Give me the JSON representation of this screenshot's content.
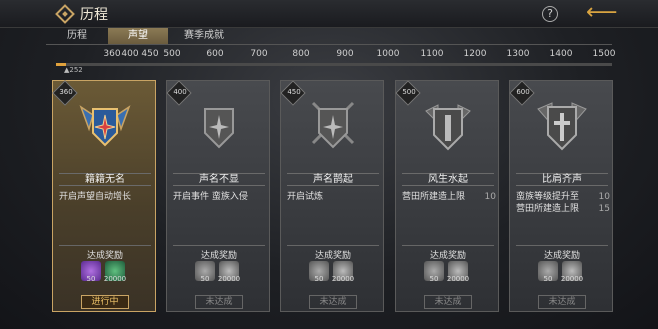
{
  "header": {
    "title": "历程"
  },
  "tabs": [
    {
      "label": "历程"
    },
    {
      "label": "声望",
      "active": true
    },
    {
      "label": "赛季成就"
    }
  ],
  "ruler": {
    "ticks": [
      "360",
      "400",
      "450",
      "500",
      "600",
      "700",
      "800",
      "900",
      "1000",
      "1100",
      "1200",
      "1300",
      "1400",
      "1500"
    ],
    "current": "252",
    "accent": "#e0a13c"
  },
  "cards": [
    {
      "level": "360",
      "name": "籍籍无名",
      "desc": [
        "开启声望自动增长"
      ],
      "reward_title": "达成奖励",
      "rewards": [
        {
          "icon": "purple-badge-icon",
          "qty": "50"
        },
        {
          "icon": "green-coin-icon",
          "qty": "20000"
        }
      ],
      "status": "进行中",
      "unlocked": true
    },
    {
      "level": "400",
      "name": "声名不显",
      "desc": [
        "开启事件 蛮族入侵"
      ],
      "reward_title": "达成奖励",
      "rewards": [
        {
          "icon": "badge-icon",
          "qty": "50"
        },
        {
          "icon": "coin-icon",
          "qty": "20000"
        }
      ],
      "status": "未达成",
      "unlocked": false
    },
    {
      "level": "450",
      "name": "声名鹊起",
      "desc": [
        "开启试炼"
      ],
      "reward_title": "达成奖励",
      "rewards": [
        {
          "icon": "badge-icon",
          "qty": "50"
        },
        {
          "icon": "coin-icon",
          "qty": "20000"
        }
      ],
      "status": "未达成",
      "unlocked": false
    },
    {
      "level": "500",
      "name": "风生水起",
      "desc": [
        "营田所建造上限"
      ],
      "desc_values": [
        "10"
      ],
      "reward_title": "达成奖励",
      "rewards": [
        {
          "icon": "badge-icon",
          "qty": "50"
        },
        {
          "icon": "coin-icon",
          "qty": "20000"
        }
      ],
      "status": "未达成",
      "unlocked": false
    },
    {
      "level": "600",
      "name": "比肩齐声",
      "desc": [
        "蛮族等级提升至",
        "营田所建造上限"
      ],
      "desc_values": [
        "10",
        "15"
      ],
      "reward_title": "达成奖励",
      "rewards": [
        {
          "icon": "badge-icon",
          "qty": "50"
        },
        {
          "icon": "coin-icon",
          "qty": "20000"
        }
      ],
      "status": "未达成",
      "unlocked": false
    }
  ]
}
